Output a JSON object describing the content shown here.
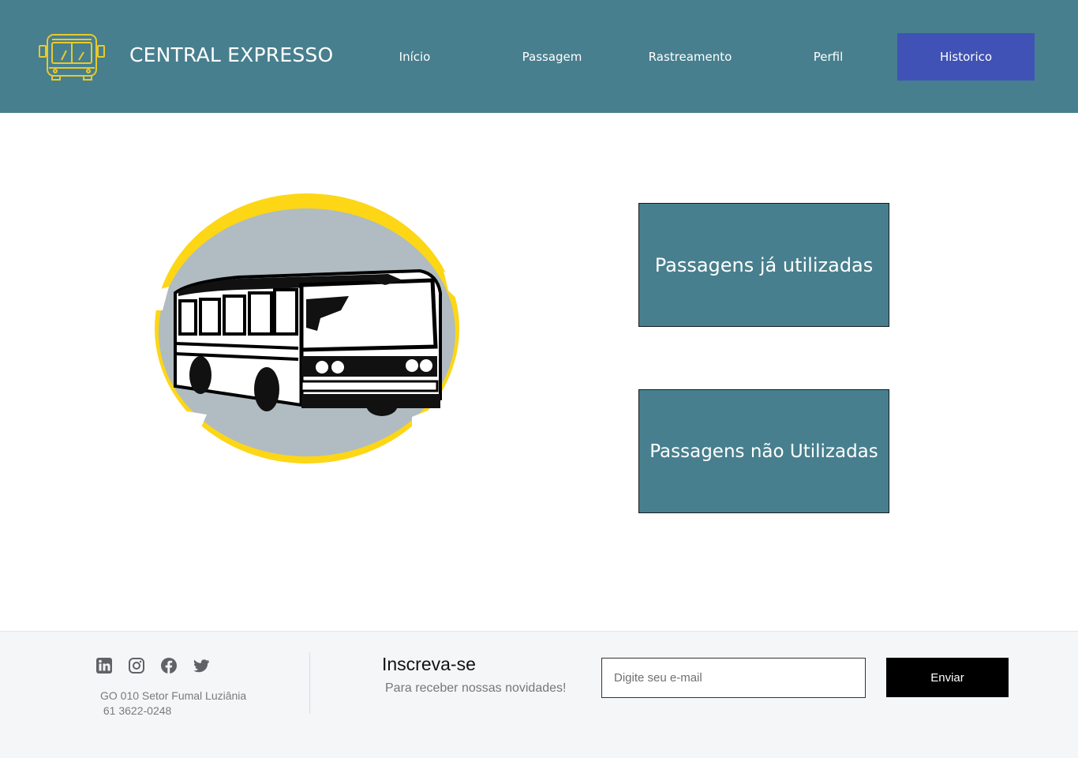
{
  "header": {
    "brand": "CENTRAL EXPRESSO",
    "logo_icon": "bus-outline-icon",
    "nav": {
      "inicio": "Início",
      "passagem": "Passagem",
      "rastreamento": "Rastreamento",
      "perfil": "Perfil",
      "historico": "Historico"
    },
    "active_nav": "Historico"
  },
  "main": {
    "illustration_icon": "bus-illustration",
    "buttons": {
      "used": "Passagens já utilizadas",
      "unused": "Passagens não Utilizadas"
    }
  },
  "footer": {
    "social_icons": [
      "linkedin-icon",
      "instagram-icon",
      "facebook-icon",
      "twitter-icon"
    ],
    "address_line1": "GO 010 Setor Fumal Luziânia",
    "address_line2": " 61 3622-0248",
    "subscribe_title": "Inscreva-se",
    "subscribe_subtitle": "Para receber nossas novidades!",
    "email_placeholder": "Digite seu e-mail",
    "send_label": "Enviar"
  },
  "colors": {
    "header_bg": "#477f8e",
    "active_nav_bg": "#4052b5",
    "logo_yellow": "#e9c92c",
    "ring_yellow": "#fdd616",
    "circle_gray": "#b0bcc1",
    "footer_bg": "#f5f6f8"
  }
}
